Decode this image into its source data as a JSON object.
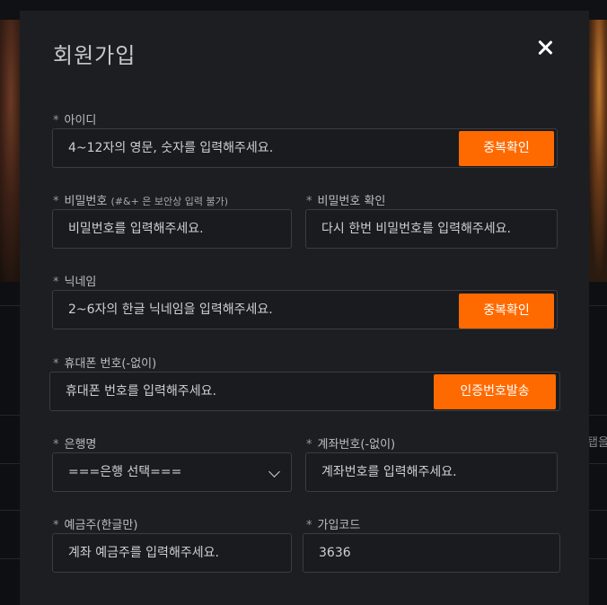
{
  "background": {
    "side_text": "탭을"
  },
  "modal": {
    "title": "회원가입",
    "required_mark": "*",
    "fields": {
      "user_id": {
        "label": "아이디",
        "placeholder": "4~12자의 영문, 숫자를 입력해주세요.",
        "button": "중복확인"
      },
      "password": {
        "label": "비밀번호",
        "note": "(#&+ 은 보안상 입력 불가)",
        "placeholder": "비밀번호를 입력해주세요."
      },
      "password_confirm": {
        "label": "비밀번호 확인",
        "placeholder": "다시 한번 비밀번호를 입력해주세요."
      },
      "nickname": {
        "label": "닉네임",
        "placeholder": "2~6자의 한글 닉네임을 입력해주세요.",
        "button": "중복확인"
      },
      "phone": {
        "label": "휴대폰 번호(-없이)",
        "placeholder": "휴대폰 번호를 입력해주세요.",
        "button": "인증번호발송"
      },
      "bank": {
        "label": "은행명",
        "selected": "===은행 선택==="
      },
      "account": {
        "label": "계좌번호(-없이)",
        "placeholder": "계좌번호를 입력해주세요."
      },
      "holder": {
        "label": "예금주(한글만)",
        "placeholder": "계좌 예금주를 입력해주세요."
      },
      "join_code": {
        "label": "가입코드",
        "value": "3636"
      }
    }
  },
  "colors": {
    "accent": "#ff6a00",
    "modal_bg": "#1d1e22",
    "field_border": "#3a3c42"
  }
}
